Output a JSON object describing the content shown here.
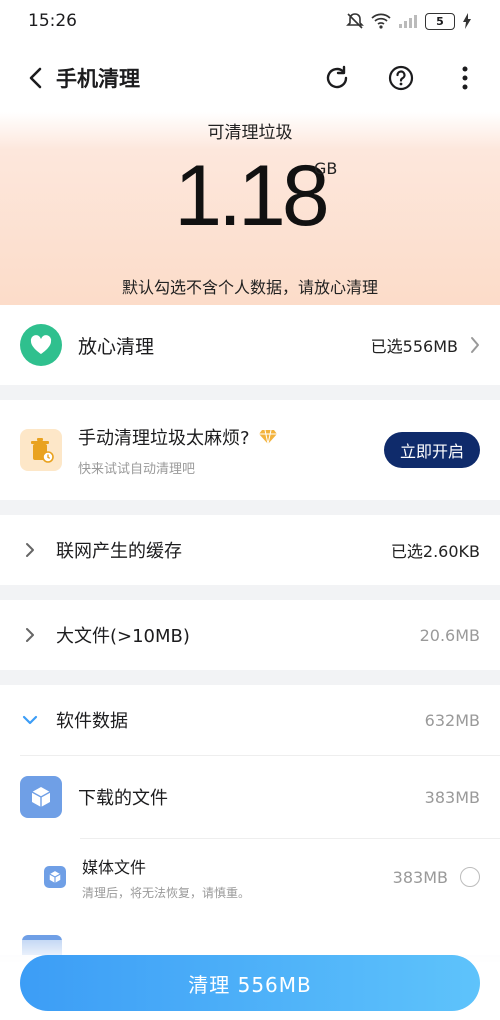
{
  "status_bar": {
    "time": "15:26",
    "battery": "5"
  },
  "header": {
    "title": "手机清理"
  },
  "summary": {
    "label": "可清理垃圾",
    "size": "1.18",
    "unit": "GB",
    "note": "默认勾选不含个人数据，请放心清理"
  },
  "safe_clean": {
    "title": "放心清理",
    "value": "已选556MB"
  },
  "promo": {
    "title": "手动清理垃圾太麻烦?",
    "subtitle": "快来试试自动清理吧",
    "button": "立即开启"
  },
  "sections": {
    "cache": {
      "label": "联网产生的缓存",
      "value": "已选2.60KB"
    },
    "large_files": {
      "label": "大文件(>10MB)",
      "value": "20.6MB"
    },
    "software": {
      "label": "软件数据",
      "value": "632MB",
      "downloads": {
        "label": "下载的文件",
        "value": "383MB"
      },
      "media": {
        "label": "媒体文件",
        "subtitle": "清理后，将无法恢复，请慎重。",
        "value": "383MB"
      }
    }
  },
  "footer": {
    "clean_button": "清理 556MB"
  },
  "colors": {
    "accent": "#3c9df6",
    "safe_green": "#2fc08e",
    "enable_button": "#0f2b6b",
    "file_icon": "#6f9fe6"
  },
  "icons": [
    "back-icon",
    "refresh-icon",
    "help-icon",
    "more-icon",
    "heart-icon",
    "trash-icon",
    "diamond-icon",
    "chevron-right-icon",
    "chevron-down-icon",
    "box-icon"
  ]
}
